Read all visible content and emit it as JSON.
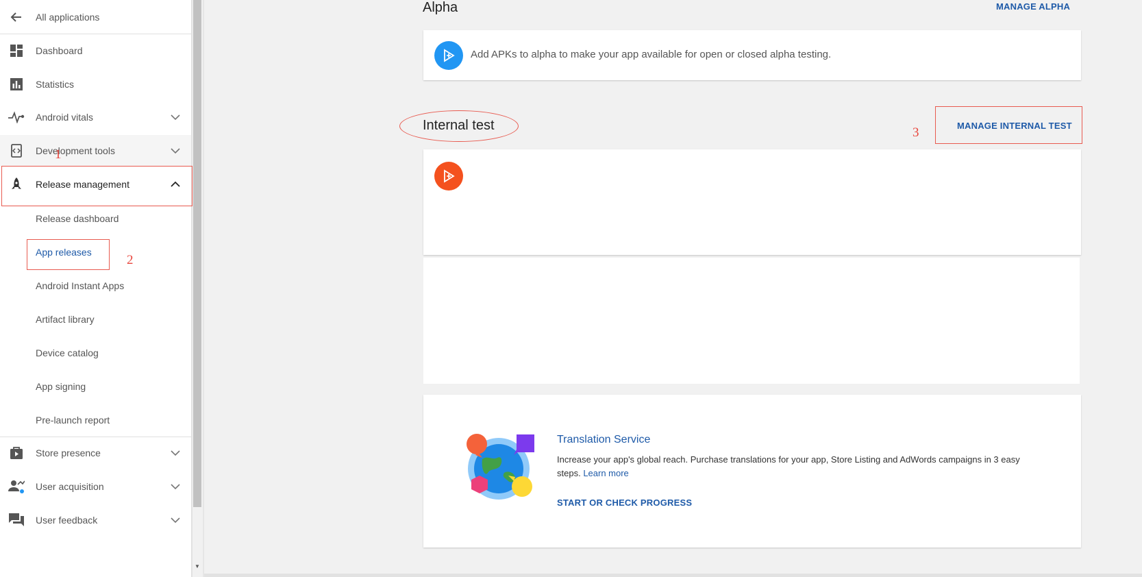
{
  "sidebar": {
    "back": {
      "label": "All applications",
      "icon": "arrow-back-icon"
    },
    "items": [
      {
        "label": "Dashboard",
        "icon": "dashboard-icon"
      },
      {
        "label": "Statistics",
        "icon": "bar-chart-icon"
      },
      {
        "label": "Android vitals",
        "icon": "pulse-icon"
      },
      {
        "label": "Development tools",
        "icon": "code-device-icon"
      },
      {
        "label": "Release management",
        "icon": "rocket-icon"
      }
    ],
    "sub_items": [
      "Release dashboard",
      "App releases",
      "Android Instant Apps",
      "Artifact library",
      "Device catalog",
      "App signing",
      "Pre-launch report"
    ],
    "bottom_items": [
      {
        "label": "Store presence",
        "icon": "store-icon"
      },
      {
        "label": "User acquisition",
        "icon": "user-acquisition-icon"
      },
      {
        "label": "User feedback",
        "icon": "feedback-icon"
      }
    ]
  },
  "annotations": {
    "n1": "1",
    "n2": "2",
    "n3": "3"
  },
  "main": {
    "alpha": {
      "title": "Alpha",
      "manage": "MANAGE ALPHA",
      "message": "Add APKs to alpha to make your app available for open or closed alpha testing."
    },
    "internal": {
      "title": "Internal test",
      "manage": "MANAGE INTERNAL TEST"
    },
    "translation": {
      "title": "Translation Service",
      "body": "Increase your app's global reach. Purchase translations for your app, Store Listing and AdWords campaigns in 3 easy steps.",
      "learn_more": "Learn more",
      "cta": "START OR CHECK PROGRESS"
    }
  },
  "colors": {
    "accent": "#1e5aa8",
    "annotation": "#e85a4f",
    "alpha_icon": "#2196f3",
    "internal_icon": "#f4511e"
  }
}
